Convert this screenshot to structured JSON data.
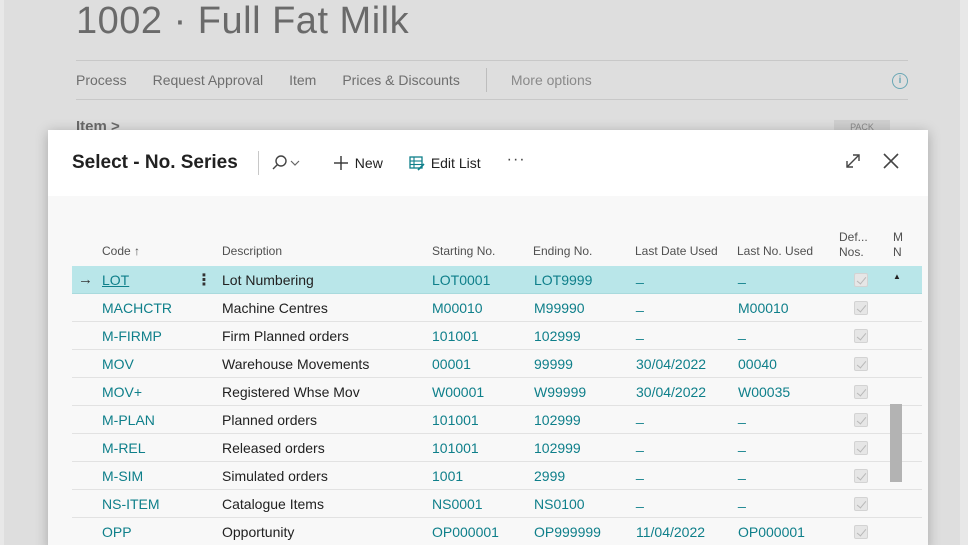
{
  "background": {
    "title": "1002 · Full Fat Milk",
    "actions": [
      "Process",
      "Request Approval",
      "Item",
      "Prices & Discounts"
    ],
    "more_options": "More options",
    "section": "Item >",
    "pack_label": "PACK"
  },
  "dialog": {
    "title": "Select - No. Series",
    "new_label": "New",
    "edit_list_label": "Edit List",
    "more_label": "···"
  },
  "columns": {
    "code": "Code ↑",
    "description": "Description",
    "starting": "Starting No.",
    "ending": "Ending No.",
    "last_date": "Last Date Used",
    "last_no": "Last No. Used",
    "default_line1": "Def...",
    "default_line2": "Nos.",
    "manual_line1": "M",
    "manual_line2": "N"
  },
  "rows": [
    {
      "code": "LOT",
      "description": "Lot Numbering",
      "starting": "LOT0001",
      "ending": "LOT9999",
      "last_date": "_",
      "last_no": "_"
    },
    {
      "code": "MACHCTR",
      "description": "Machine Centres",
      "starting": "M00010",
      "ending": "M99990",
      "last_date": "_",
      "last_no": "M00010"
    },
    {
      "code": "M-FIRMP",
      "description": "Firm Planned orders",
      "starting": "101001",
      "ending": "102999",
      "last_date": "_",
      "last_no": "_"
    },
    {
      "code": "MOV",
      "description": "Warehouse Movements",
      "starting": "00001",
      "ending": "99999",
      "last_date": "30/04/2022",
      "last_no": "00040"
    },
    {
      "code": "MOV+",
      "description": "Registered Whse Mov",
      "starting": "W00001",
      "ending": "W99999",
      "last_date": "30/04/2022",
      "last_no": "W00035"
    },
    {
      "code": "M-PLAN",
      "description": "Planned orders",
      "starting": "101001",
      "ending": "102999",
      "last_date": "_",
      "last_no": "_"
    },
    {
      "code": "M-REL",
      "description": "Released orders",
      "starting": "101001",
      "ending": "102999",
      "last_date": "_",
      "last_no": "_"
    },
    {
      "code": "M-SIM",
      "description": "Simulated orders",
      "starting": "1001",
      "ending": "2999",
      "last_date": "_",
      "last_no": "_"
    },
    {
      "code": "NS-ITEM",
      "description": "Catalogue Items",
      "starting": "NS0001",
      "ending": "NS0100",
      "last_date": "_",
      "last_no": "_"
    },
    {
      "code": "OPP",
      "description": "Opportunity",
      "starting": "OP000001",
      "ending": "OP999999",
      "last_date": "11/04/2022",
      "last_no": "OP000001"
    }
  ],
  "colors": {
    "accent": "#0e7f8a",
    "selected_row": "#b9e6e9"
  }
}
